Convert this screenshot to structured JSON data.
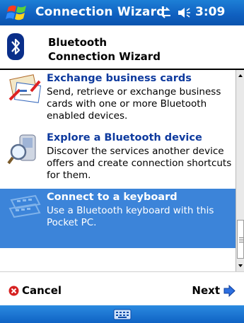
{
  "titlebar": {
    "title": "Connection Wizard",
    "clock": "3:09",
    "icons": [
      "windows-flag-icon",
      "connectivity-icon",
      "volume-icon"
    ]
  },
  "header": {
    "line1": "Bluetooth",
    "line2": "Connection Wizard",
    "icon": "bluetooth-icon"
  },
  "items": [
    {
      "label": "Exchange business cards",
      "desc": "Send, retrieve or exchange business cards with one or more Bluetooth enabled devices.",
      "icon": "business-cards-icon",
      "selected": false
    },
    {
      "label": "Explore a Bluetooth device",
      "desc": "Discover the services another device offers and create connection shortcuts for them.",
      "icon": "explore-device-icon",
      "selected": false
    },
    {
      "label": "Connect to a keyboard",
      "desc": "Use a Bluetooth keyboard with this Pocket PC.",
      "icon": "keyboard-icon",
      "selected": true
    }
  ],
  "menubar": {
    "cancel_label": "Cancel",
    "next_label": "Next"
  },
  "sipbar": {
    "icon": "keyboard-sip-icon"
  },
  "colors": {
    "titlebar": "#1166c8",
    "selection": "#3c84d9",
    "link_text": "#0e3a9e"
  }
}
